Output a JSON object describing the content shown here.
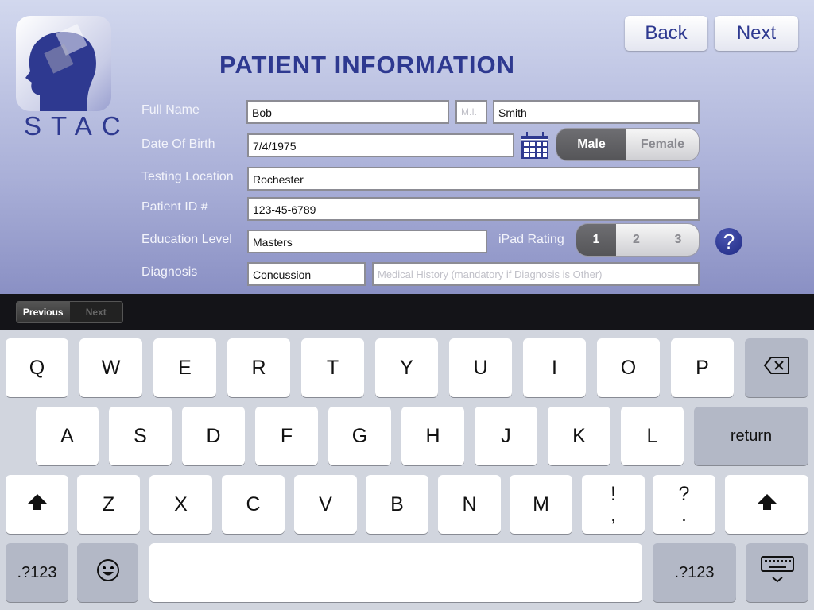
{
  "app": {
    "logo_text": "STAC",
    "title": "PATIENT INFORMATION",
    "back": "Back",
    "next": "Next"
  },
  "form": {
    "full_name_label": "Full Name",
    "first_name": "Bob",
    "mi_placeholder": "M.I.",
    "last_name": "Smith",
    "dob_label": "Date Of Birth",
    "dob": "7/4/1975",
    "gender_options": [
      "Male",
      "Female"
    ],
    "gender_selected": "Male",
    "location_label": "Testing Location",
    "location": "Rochester",
    "patient_id_label": "Patient ID #",
    "patient_id": "123-45-6789",
    "education_label": "Education Level",
    "education": "Masters",
    "ipad_rating_label": "iPad Rating",
    "rating_options": [
      "1",
      "2",
      "3"
    ],
    "rating_selected": "1",
    "help": "?",
    "diagnosis_label": "Diagnosis",
    "diagnosis": "Concussion",
    "history_placeholder": "Medical History (mandatory if Diagnosis is Other)"
  },
  "toolbar": {
    "previous": "Previous",
    "next": "Next"
  },
  "keyboard": {
    "rows": [
      [
        "Q",
        "W",
        "E",
        "R",
        "T",
        "Y",
        "U",
        "I",
        "O",
        "P",
        "backspace-icon"
      ],
      [
        "A",
        "S",
        "D",
        "F",
        "G",
        "H",
        "J",
        "K",
        "L",
        "return"
      ],
      [
        "shift-icon",
        "Z",
        "X",
        "C",
        "V",
        "B",
        "N",
        "M",
        "!\n,",
        "?\n.",
        "shift-icon"
      ],
      [
        ".?123",
        "emoji-icon",
        "",
        ".?123",
        "keyboard-dismiss-icon"
      ]
    ]
  }
}
